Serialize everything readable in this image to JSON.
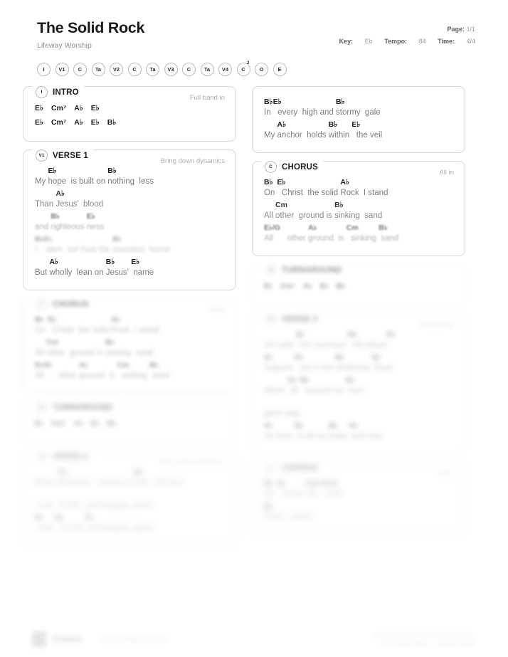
{
  "header": {
    "title": "The Solid Rock",
    "artist": "Lifeway Worship",
    "page_label": "Page:",
    "page_value": "1/1",
    "key_label": "Key:",
    "key_value": "Eb",
    "tempo_label": "Tempo:",
    "tempo_value": "84",
    "time_label": "Time:",
    "time_value": "4/4"
  },
  "arrangement": [
    {
      "label": "I",
      "sup": ""
    },
    {
      "label": "V1",
      "sup": ""
    },
    {
      "label": "C",
      "sup": ""
    },
    {
      "label": "Ta",
      "sup": ""
    },
    {
      "label": "V2",
      "sup": ""
    },
    {
      "label": "C",
      "sup": ""
    },
    {
      "label": "Ta",
      "sup": ""
    },
    {
      "label": "V3",
      "sup": ""
    },
    {
      "label": "C",
      "sup": ""
    },
    {
      "label": "Ta",
      "sup": ""
    },
    {
      "label": "V4",
      "sup": ""
    },
    {
      "label": "C",
      "sup": "2"
    },
    {
      "label": "O",
      "sup": ""
    },
    {
      "label": "E",
      "sup": ""
    }
  ],
  "sections": {
    "intro": {
      "badge": "I",
      "name": "INTRO",
      "note": "Full band in",
      "lines": [
        {
          "chords_only": true,
          "cells": [
            {
              "chord": "E♭",
              "lyric": ""
            },
            {
              "chord": "Cm⁷",
              "lyric": ""
            },
            {
              "chord": "A♭",
              "lyric": ""
            },
            {
              "chord": "E♭",
              "lyric": ""
            }
          ]
        },
        {
          "chords_only": true,
          "cells": [
            {
              "chord": "E♭",
              "lyric": ""
            },
            {
              "chord": "Cm⁷",
              "lyric": ""
            },
            {
              "chord": "A♭",
              "lyric": ""
            },
            {
              "chord": "E♭",
              "lyric": ""
            },
            {
              "chord": "B♭",
              "lyric": ""
            }
          ]
        }
      ]
    },
    "verse1": {
      "badge": "V1",
      "name": "VERSE 1",
      "note": "Bring down dynamics",
      "lines": [
        {
          "cells": [
            {
              "chord": "",
              "lyric": "My "
            },
            {
              "chord": "E♭",
              "lyric": "hope "
            },
            {
              "chord": "",
              "lyric": " is built on "
            },
            {
              "chord": "B♭",
              "lyric": "nothing "
            },
            {
              "chord": "",
              "lyric": " less"
            }
          ]
        },
        {
          "cells": [
            {
              "chord": "",
              "lyric": "Than "
            },
            {
              "chord": "A♭",
              "lyric": "Jesus' "
            },
            {
              "chord": "",
              "lyric": " blood"
            }
          ]
        },
        {
          "cells": [
            {
              "chord": "",
              "lyric": "and "
            },
            {
              "chord": "B♭",
              "lyric": "righteous "
            },
            {
              "chord": "E♭",
              "lyric": "ness"
            }
          ]
        },
        {
          "cells": [
            {
              "chord": "B♭",
              "lyric": "I "
            },
            {
              "chord": "E♭",
              "lyric": " dare "
            },
            {
              "chord": "",
              "lyric": " not trust the "
            },
            {
              "chord": "B♭",
              "lyric": "sweetest "
            },
            {
              "chord": "",
              "lyric": " frame"
            }
          ]
        },
        {
          "cells": [
            {
              "chord": "",
              "lyric": "But "
            },
            {
              "chord": "A♭",
              "lyric": "wholly "
            },
            {
              "chord": "",
              "lyric": " lean on "
            },
            {
              "chord": "B♭",
              "lyric": "Jesus' "
            },
            {
              "chord": "E♭",
              "lyric": " name"
            }
          ]
        }
      ]
    },
    "verse1_cont": {
      "badge": "",
      "name": "",
      "note": "",
      "lines": [
        {
          "cells": [
            {
              "chord": "B♭",
              "lyric": "In "
            },
            {
              "chord": "E♭",
              "lyric": "  every "
            },
            {
              "chord": "",
              "lyric": " high and "
            },
            {
              "chord": "B♭",
              "lyric": "stormy "
            },
            {
              "chord": "",
              "lyric": " gale"
            }
          ]
        },
        {
          "cells": [
            {
              "chord": "",
              "lyric": "My "
            },
            {
              "chord": "A♭",
              "lyric": "anchor "
            },
            {
              "chord": "",
              "lyric": " holds "
            },
            {
              "chord": "B♭",
              "lyric": "within "
            },
            {
              "chord": "E♭",
              "lyric": "  the veil"
            }
          ]
        }
      ]
    },
    "chorus": {
      "badge": "C",
      "name": "CHORUS",
      "note": "All in",
      "lines": [
        {
          "cells": [
            {
              "chord": "B♭",
              "lyric": "On "
            },
            {
              "chord": "E♭",
              "lyric": "  Christ "
            },
            {
              "chord": "",
              "lyric": " the solid "
            },
            {
              "chord": "A♭",
              "lyric": "Rock "
            },
            {
              "chord": "",
              "lyric": " I stand"
            }
          ]
        },
        {
          "cells": [
            {
              "chord": "",
              "lyric": "All "
            },
            {
              "chord": "Cm",
              "lyric": "other "
            },
            {
              "chord": "",
              "lyric": " ground is "
            },
            {
              "chord": "B♭",
              "lyric": "sinking "
            },
            {
              "chord": "",
              "lyric": " sand"
            }
          ]
        },
        {
          "cells": [
            {
              "chord": "E♭/G",
              "lyric": "All "
            },
            {
              "chord": "",
              "lyric": "   other "
            },
            {
              "chord": "A♭",
              "lyric": "ground "
            },
            {
              "chord": "",
              "lyric": " is "
            },
            {
              "chord": "Cm",
              "lyric": "  sinking "
            },
            {
              "chord": "B♭",
              "lyric": " sand"
            }
          ]
        }
      ]
    },
    "turnaround_r": {
      "badge": "Ta",
      "name": "TURNAROUND",
      "note": "",
      "lines": [
        {
          "chords_only": true,
          "cells": [
            {
              "chord": "E♭",
              "lyric": ""
            },
            {
              "chord": "Cm⁷",
              "lyric": ""
            },
            {
              "chord": "A♭",
              "lyric": ""
            },
            {
              "chord": "E♭",
              "lyric": ""
            },
            {
              "chord": "B♭",
              "lyric": ""
            }
          ]
        }
      ]
    },
    "chorus_l": {
      "badge": "C",
      "name": "CHORUS",
      "note": "All in",
      "lines": [
        {
          "cells": [
            {
              "chord": "B♭",
              "lyric": "On "
            },
            {
              "chord": "E♭",
              "lyric": "  Christ "
            },
            {
              "chord": "",
              "lyric": " the solid "
            },
            {
              "chord": "A♭",
              "lyric": "Rock "
            },
            {
              "chord": "",
              "lyric": " I stand"
            }
          ]
        },
        {
          "cells": [
            {
              "chord": "",
              "lyric": "All "
            },
            {
              "chord": "Cm",
              "lyric": "other "
            },
            {
              "chord": "",
              "lyric": " ground is "
            },
            {
              "chord": "B♭",
              "lyric": "sinking "
            },
            {
              "chord": "",
              "lyric": " sand"
            }
          ]
        },
        {
          "cells": [
            {
              "chord": "E♭/G",
              "lyric": "All "
            },
            {
              "chord": "",
              "lyric": "   other "
            },
            {
              "chord": "A♭",
              "lyric": "ground "
            },
            {
              "chord": "",
              "lyric": " is "
            },
            {
              "chord": "Cm",
              "lyric": "  sinking "
            },
            {
              "chord": "B♭",
              "lyric": " sand"
            }
          ]
        }
      ]
    },
    "turnaround_l": {
      "badge": "Ta",
      "name": "TURNAROUND",
      "note": "",
      "lines": [
        {
          "chords_only": true,
          "cells": [
            {
              "chord": "E♭",
              "lyric": ""
            },
            {
              "chord": "Cm⁷",
              "lyric": ""
            },
            {
              "chord": "A♭",
              "lyric": ""
            },
            {
              "chord": "E♭",
              "lyric": ""
            },
            {
              "chord": "B♭",
              "lyric": ""
            }
          ]
        }
      ]
    },
    "verse2": {
      "badge": "V2",
      "name": "VERSE 2",
      "note": "Bring down dynamics",
      "lines": [
        {
          "cells": [
            {
              "chord": "",
              "lyric": "When "
            },
            {
              "chord": "E♭",
              "lyric": "darkness "
            },
            {
              "chord": "",
              "lyric": "  seems to "
            },
            {
              "chord": "B♭",
              "lyric": "hide "
            },
            {
              "chord": "",
              "lyric": " His face"
            }
          ]
        },
        {
          "cells": [
            {
              "chord": "",
              "lyric": "I rest "
            },
            {
              "chord": "",
              "lyric": " on His "
            },
            {
              "chord": "",
              "lyric": " unchanging "
            },
            {
              "chord": "",
              "lyric": " grace"
            }
          ]
        },
        {
          "cells": [
            {
              "chord": "E♭",
              "lyric": "I rest "
            },
            {
              "chord": "B♭",
              "lyric": "  on His "
            },
            {
              "chord": "E♭",
              "lyric": " unchanging "
            },
            {
              "chord": "",
              "lyric": " grace"
            }
          ]
        }
      ]
    },
    "verse3": {
      "badge": "V3",
      "name": "VERSE 3",
      "note": "Breakdown",
      "lines": [
        {
          "cells": [
            {
              "chord": "",
              "lyric": "His oath "
            },
            {
              "chord": "E♭",
              "lyric": " His covenant "
            },
            {
              "chord": "B♭",
              "lyric": "  His blood"
            },
            {
              "chord": "E♭",
              "lyric": ""
            }
          ]
        },
        {
          "cells": [
            {
              "chord": "A♭",
              "lyric": "Support "
            },
            {
              "chord": "E♭",
              "lyric": "  me in the "
            },
            {
              "chord": "B♭",
              "lyric": "whelming "
            },
            {
              "chord": "E♭",
              "lyric": " flood"
            }
          ]
        },
        {
          "cells": [
            {
              "chord": "",
              "lyric": "When "
            },
            {
              "chord": "A♭",
              "lyric": " all "
            },
            {
              "chord": "B♭",
              "lyric": "  around my "
            },
            {
              "chord": "E♭",
              "lyric": " soul"
            }
          ]
        },
        {
          "cells": [
            {
              "chord": "",
              "lyric": "gives way"
            }
          ]
        },
        {
          "cells": [
            {
              "chord": "A♭",
              "lyric": "He then "
            },
            {
              "chord": "E♭",
              "lyric": " is all my "
            },
            {
              "chord": "B♭",
              "lyric": "hope "
            },
            {
              "chord": "E♭",
              "lyric": " and stay"
            }
          ]
        }
      ]
    },
    "chorus_r2": {
      "badge": "C",
      "name": "CHORUS",
      "note": "All in",
      "lines": [
        {
          "cells": [
            {
              "chord": "B♭",
              "lyric": "On "
            },
            {
              "chord": "E♭",
              "lyric": "  Christ "
            },
            {
              "chord": "Cm⁷",
              "lyric": " the "
            },
            {
              "chord": "E♭/G",
              "lyric": "  solid"
            }
          ]
        },
        {
          "cells": [
            {
              "chord": "B♭",
              "lyric": "Rock "
            },
            {
              "chord": "",
              "lyric": " I stand"
            }
          ]
        }
      ]
    }
  },
  "footer": {
    "brand": "Charts",
    "url": "www.worshipcharts.com",
    "copyright_line1": "Words, Music and Arr. used by permission.",
    "copyright_line2": "CCLI Song License — Lifeway Worship"
  }
}
